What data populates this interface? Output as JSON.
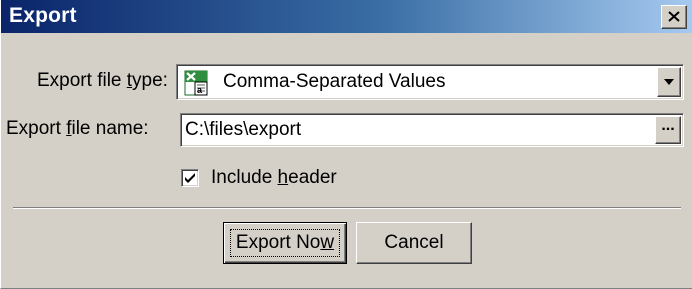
{
  "window": {
    "title": "Export",
    "close_icon": "close-icon"
  },
  "file_type": {
    "label_pre": "Export file ",
    "label_access": "t",
    "label_post": "ype:",
    "selected": "Comma-Separated Values",
    "icon": "spreadsheet-csv-icon"
  },
  "file_name": {
    "label_pre": "Export ",
    "label_access": "f",
    "label_post": "ile name:",
    "value": "C:\\files\\export",
    "browse_label": "..."
  },
  "include_header": {
    "label_pre": "Include ",
    "label_access": "h",
    "label_post": "eader",
    "checked": true
  },
  "buttons": {
    "export_pre": "Export No",
    "export_access": "w",
    "cancel": "Cancel"
  },
  "colors": {
    "title_gradient_start": "#0a246a",
    "title_gradient_end": "#a6caf0",
    "dialog_face": "#d4d0c8"
  }
}
